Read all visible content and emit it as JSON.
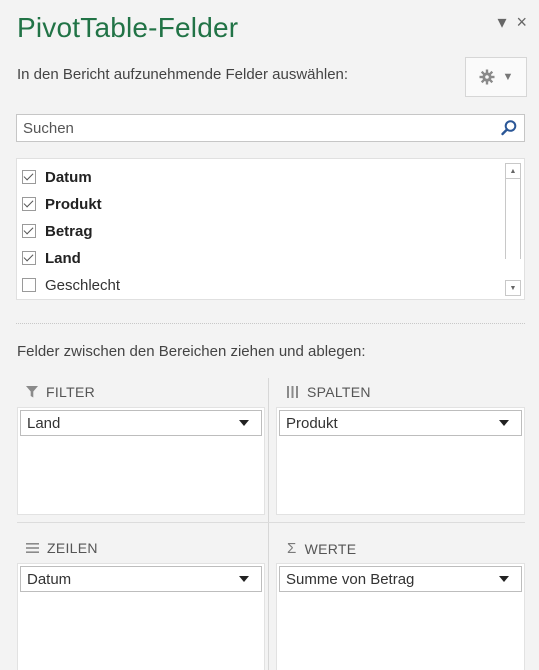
{
  "pane": {
    "title": "PivotTable-Felder",
    "window_controls": {
      "dropdown": "▾",
      "close": "×"
    },
    "instruction": "In den Bericht aufzunehmende Felder auswählen:",
    "settings_icon": "gear-icon",
    "search_placeholder": "Suchen"
  },
  "fields": [
    {
      "label": "Datum",
      "checked": true
    },
    {
      "label": "Produkt",
      "checked": true
    },
    {
      "label": "Betrag",
      "checked": true
    },
    {
      "label": "Land",
      "checked": true
    },
    {
      "label": "Geschlecht",
      "checked": false
    }
  ],
  "areas": {
    "instruction": "Felder zwischen den Bereichen ziehen und ablegen:",
    "filter": {
      "label": "FILTER",
      "icon": "filter-icon",
      "value": "Land"
    },
    "columns": {
      "label": "SPALTEN",
      "icon": "columns-icon",
      "value": "Produkt"
    },
    "rows": {
      "label": "ZEILEN",
      "icon": "rows-icon",
      "value": "Datum"
    },
    "values": {
      "label": "WERTE",
      "icon": "sigma-icon",
      "value": "Summe von Betrag"
    }
  },
  "colors": {
    "title": "#217346",
    "background": "#f3f3f3"
  }
}
